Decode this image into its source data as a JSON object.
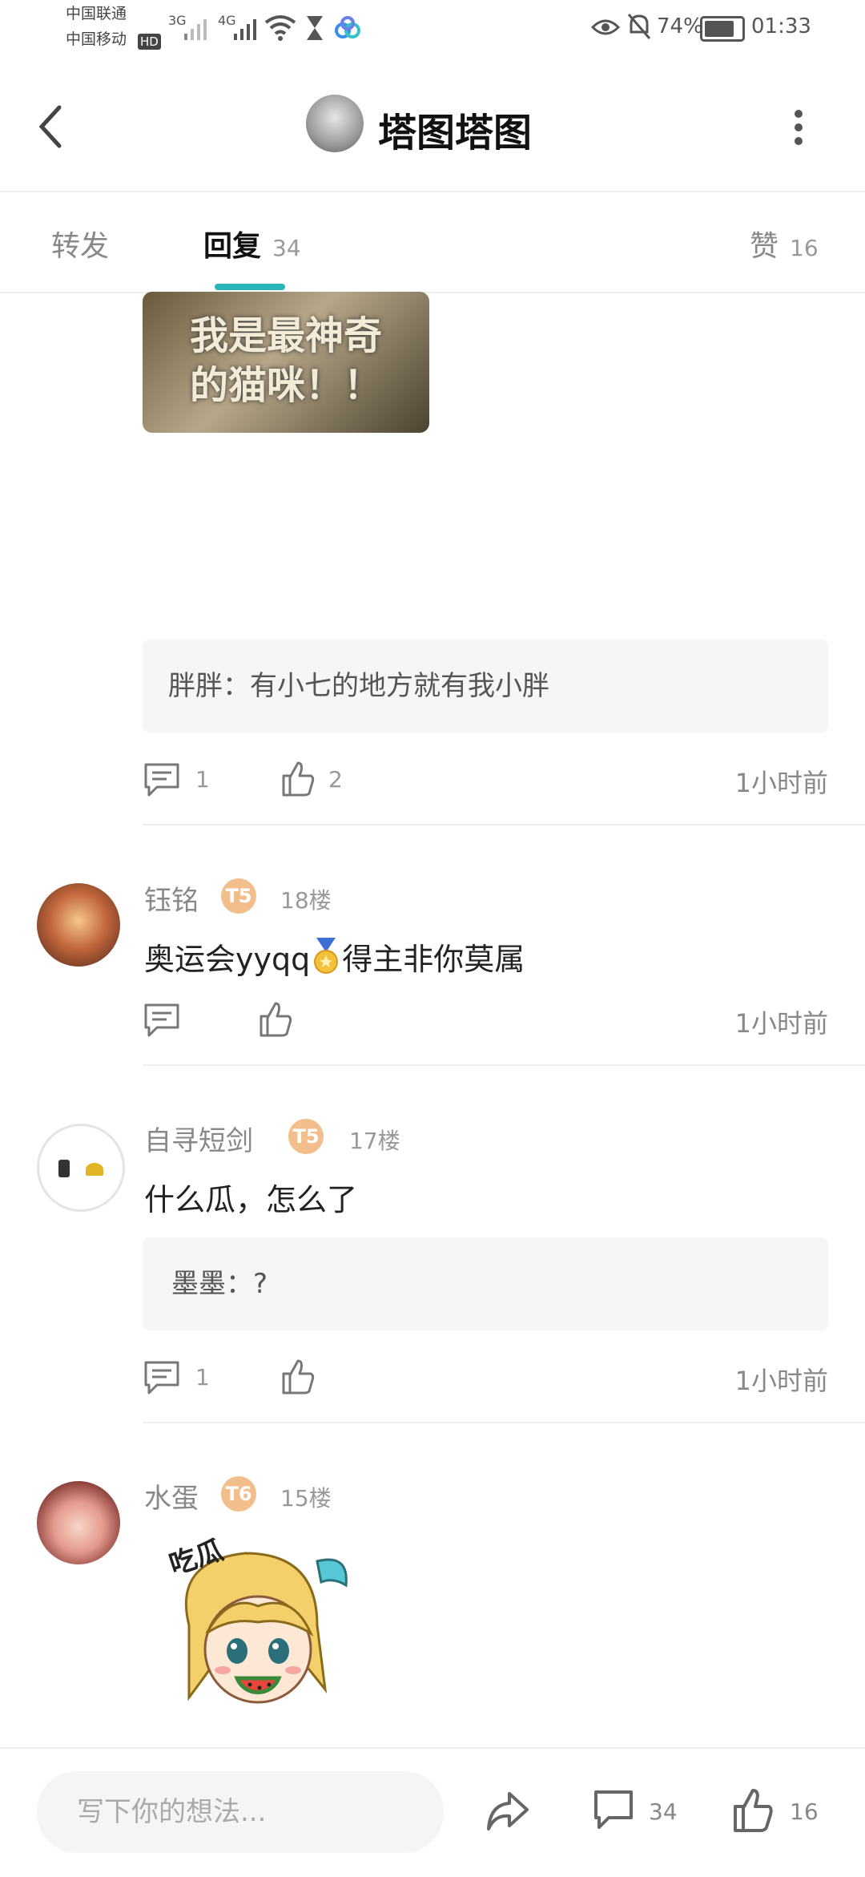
{
  "status_bar": {
    "carrier1": "中国联通",
    "carrier2": "中国移动",
    "hd": "HD",
    "net1": "3G",
    "net2": "4G",
    "battery": "74%",
    "time": "01:33"
  },
  "header": {
    "title": "塔图塔图"
  },
  "tabs": {
    "forward": "转发",
    "reply": "回复",
    "reply_count": "34",
    "like": "赞",
    "like_count": "16"
  },
  "image_text": {
    "line1": "我是最神奇",
    "line2": "的猫咪！！"
  },
  "post1": {
    "reply_name": "胖胖",
    "reply_text": "：有小七的地方就有我小胖",
    "comment_count": "1",
    "like_count": "2",
    "time": "1小时前"
  },
  "post2": {
    "username": "钰铭",
    "badge": "T5",
    "floor": "18楼",
    "text_before": "奥运会yyqq",
    "text_after": "得主非你莫属",
    "time": "1小时前"
  },
  "post3": {
    "username": "自寻短剑",
    "badge": "T5",
    "floor": "17楼",
    "text": "什么瓜，怎么了",
    "reply_name": "墨墨",
    "reply_text": "：?",
    "comment_count": "1",
    "time": "1小时前"
  },
  "post4": {
    "username": "水蛋",
    "badge": "T6",
    "floor": "15楼",
    "sticker_text": "吃瓜"
  },
  "bottom_bar": {
    "placeholder": "写下你的想法...",
    "comment_count": "34",
    "like_count": "16"
  },
  "colors": {
    "accent": "#2bb3bb",
    "badge": "#f2be8c"
  }
}
